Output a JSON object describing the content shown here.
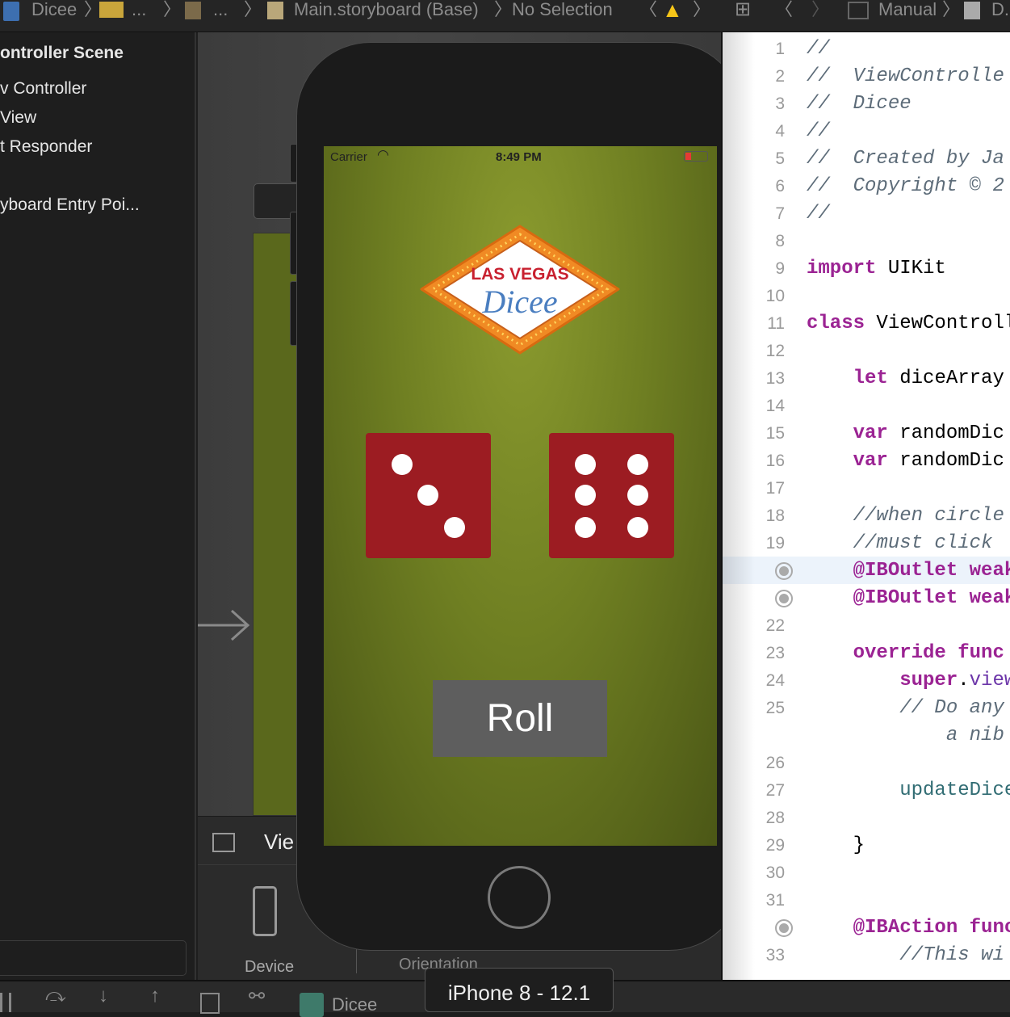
{
  "topbar": {
    "breadcrumbs": [
      "Dicee",
      "...",
      "...",
      "Main.storyboard (Base)",
      "No Selection"
    ],
    "right_breadcrumbs": [
      "Manual",
      "D..."
    ],
    "warning_color": "#f5c518"
  },
  "outline": {
    "items": [
      "ontroller Scene",
      "v Controller",
      "View",
      "t Responder",
      "yboard Entry Poi..."
    ]
  },
  "canvas": {
    "view_as_label": "Vie",
    "device_label": "Device",
    "orientation_label": "Orientation"
  },
  "phone": {
    "status": {
      "carrier": "Carrier",
      "time": "8:49 PM",
      "battery_color": "#e53935"
    },
    "logo": {
      "line1": "LAS VEGAS",
      "line2": "Dicee"
    },
    "dice": [
      3,
      6
    ],
    "die_color": "#9c1c22",
    "roll_label": "Roll"
  },
  "code": {
    "lines": [
      {
        "n": "1",
        "parts": [
          [
            "comment",
            "//"
          ]
        ]
      },
      {
        "n": "2",
        "parts": [
          [
            "comment",
            "//  ViewControlle"
          ]
        ]
      },
      {
        "n": "3",
        "parts": [
          [
            "comment",
            "//  Dicee"
          ]
        ]
      },
      {
        "n": "4",
        "parts": [
          [
            "comment",
            "//"
          ]
        ]
      },
      {
        "n": "5",
        "parts": [
          [
            "comment",
            "//  Created by Ja"
          ]
        ]
      },
      {
        "n": "6",
        "parts": [
          [
            "comment",
            "//  Copyright © 2"
          ]
        ]
      },
      {
        "n": "7",
        "parts": [
          [
            "comment",
            "//"
          ]
        ]
      },
      {
        "n": "8",
        "parts": []
      },
      {
        "n": "9",
        "parts": [
          [
            "kw",
            "import"
          ],
          [
            "",
            " UIKit"
          ]
        ]
      },
      {
        "n": "10",
        "parts": []
      },
      {
        "n": "11",
        "parts": [
          [
            "kw",
            "class"
          ],
          [
            "",
            " ViewControll"
          ]
        ]
      },
      {
        "n": "12",
        "parts": []
      },
      {
        "n": "13",
        "parts": [
          [
            "",
            "    "
          ],
          [
            "kw",
            "let"
          ],
          [
            "",
            " diceArray"
          ]
        ]
      },
      {
        "n": "14",
        "parts": []
      },
      {
        "n": "15",
        "parts": [
          [
            "",
            "    "
          ],
          [
            "kw",
            "var"
          ],
          [
            "",
            " randomDic"
          ]
        ]
      },
      {
        "n": "16",
        "parts": [
          [
            "",
            "    "
          ],
          [
            "kw",
            "var"
          ],
          [
            "",
            " randomDic"
          ]
        ]
      },
      {
        "n": "17",
        "parts": []
      },
      {
        "n": "18",
        "parts": [
          [
            "comment",
            "    //when circle"
          ]
        ]
      },
      {
        "n": "19",
        "parts": [
          [
            "comment",
            "    //must click"
          ]
        ]
      },
      {
        "n": "outlet",
        "parts": [
          [
            "",
            "    "
          ],
          [
            "kw",
            "@IBOutlet weak"
          ]
        ]
      },
      {
        "n": "outlet",
        "parts": [
          [
            "",
            "    "
          ],
          [
            "kw",
            "@IBOutlet weak"
          ]
        ]
      },
      {
        "n": "22",
        "parts": []
      },
      {
        "n": "23",
        "parts": [
          [
            "",
            "    "
          ],
          [
            "kw",
            "override func"
          ]
        ]
      },
      {
        "n": "24",
        "parts": [
          [
            "",
            "        "
          ],
          [
            "kw",
            "super"
          ],
          [
            "",
            "."
          ],
          [
            "prop",
            "view"
          ]
        ]
      },
      {
        "n": "25",
        "parts": [
          [
            "comment",
            "        // Do any"
          ]
        ]
      },
      {
        "n": "",
        "parts": [
          [
            "comment",
            "            a nib"
          ]
        ]
      },
      {
        "n": "26",
        "parts": []
      },
      {
        "n": "27",
        "parts": [
          [
            "",
            "        "
          ],
          [
            "fn",
            "updateDice"
          ]
        ]
      },
      {
        "n": "28",
        "parts": []
      },
      {
        "n": "29",
        "parts": [
          [
            "",
            "    }"
          ]
        ]
      },
      {
        "n": "30",
        "parts": []
      },
      {
        "n": "31",
        "parts": []
      },
      {
        "n": "outlet",
        "parts": [
          [
            "",
            "    "
          ],
          [
            "kw",
            "@IBAction func"
          ]
        ]
      },
      {
        "n": "33",
        "parts": [
          [
            "comment",
            "        //This wi"
          ]
        ]
      }
    ]
  },
  "bottombar": {
    "scheme": "Dicee",
    "tooltip": "iPhone 8 - 12.1"
  }
}
